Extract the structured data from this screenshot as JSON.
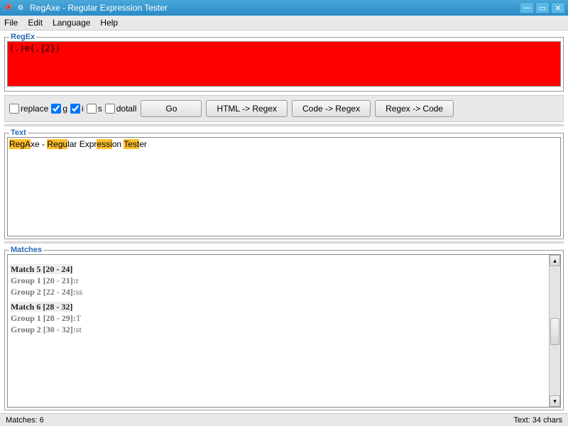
{
  "window": {
    "title": "RegAxe - Regular Expression Tester"
  },
  "menu": {
    "file": "File",
    "edit": "Edit",
    "language": "Language",
    "help": "Help"
  },
  "regex": {
    "legend": "RegEx",
    "value": "(.)e(.{2})"
  },
  "options": {
    "replace": "replace",
    "g": "g",
    "i": "i",
    "s": "s",
    "dotall": "dotall",
    "checked": {
      "replace": false,
      "g": true,
      "i": true,
      "s": false,
      "dotall": false
    }
  },
  "buttons": {
    "go": "Go",
    "html_to_regex": "HTML -> Regex",
    "code_to_regex": "Code -> Regex",
    "regex_to_code": "Regex -> Code"
  },
  "text": {
    "legend": "Text",
    "value": "RegAxe - Regular Expression Tester",
    "segments": [
      {
        "t": "RegA",
        "hl": true
      },
      {
        "t": "xe - ",
        "hl": false
      },
      {
        "t": "Regu",
        "hl": true
      },
      {
        "t": "lar Expr",
        "hl": false
      },
      {
        "t": "essi",
        "hl": true
      },
      {
        "t": "on ",
        "hl": false
      },
      {
        "t": "Test",
        "hl": true
      },
      {
        "t": "er",
        "hl": false
      }
    ]
  },
  "matches": {
    "legend": "Matches",
    "visible": [
      {
        "head": "Match 5 [20 - 24]",
        "groups": [
          {
            "label": "Group 1 [20 - 21]:",
            "val": "r"
          },
          {
            "label": "Group 2 [22 - 24]:",
            "val": "ss"
          }
        ]
      },
      {
        "head": "Match 6 [28 - 32]",
        "groups": [
          {
            "label": "Group 1 [28 - 29]:",
            "val": "T"
          },
          {
            "label": "Group 2 [30 - 32]:",
            "val": "st"
          }
        ]
      }
    ]
  },
  "status": {
    "matches": "Matches: 6",
    "chars": "Text: 34 chars"
  }
}
